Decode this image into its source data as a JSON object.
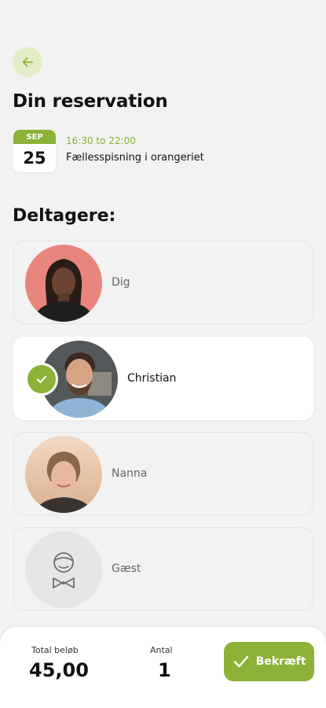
{
  "header": {
    "back_icon": "arrow-left-icon",
    "title": "Din reservation"
  },
  "event": {
    "month": "SEP",
    "day": "25",
    "time": "16:30 to 22:00",
    "name": "Fællesspisning i orangeriet"
  },
  "participants": {
    "title": "Deltagere:",
    "items": [
      {
        "name": "Dig",
        "avatar": "photo-woman-pink-background",
        "selected": false
      },
      {
        "name": "Christian",
        "avatar": "photo-man-beard",
        "selected": true
      },
      {
        "name": "Nanna",
        "avatar": "photo-woman-beach",
        "selected": false
      },
      {
        "name": "Gæst",
        "avatar": "guest-placeholder-icon",
        "selected": false
      }
    ]
  },
  "footer": {
    "total_label": "Total beløb",
    "total_value": "45,00",
    "count_label": "Antal",
    "count_value": "1",
    "confirm_label": "Bekræft",
    "confirm_icon": "checkmark-icon"
  },
  "colors": {
    "accent": "#8cb338",
    "accent_light": "#e3edc5",
    "background": "#f2f2f2"
  }
}
